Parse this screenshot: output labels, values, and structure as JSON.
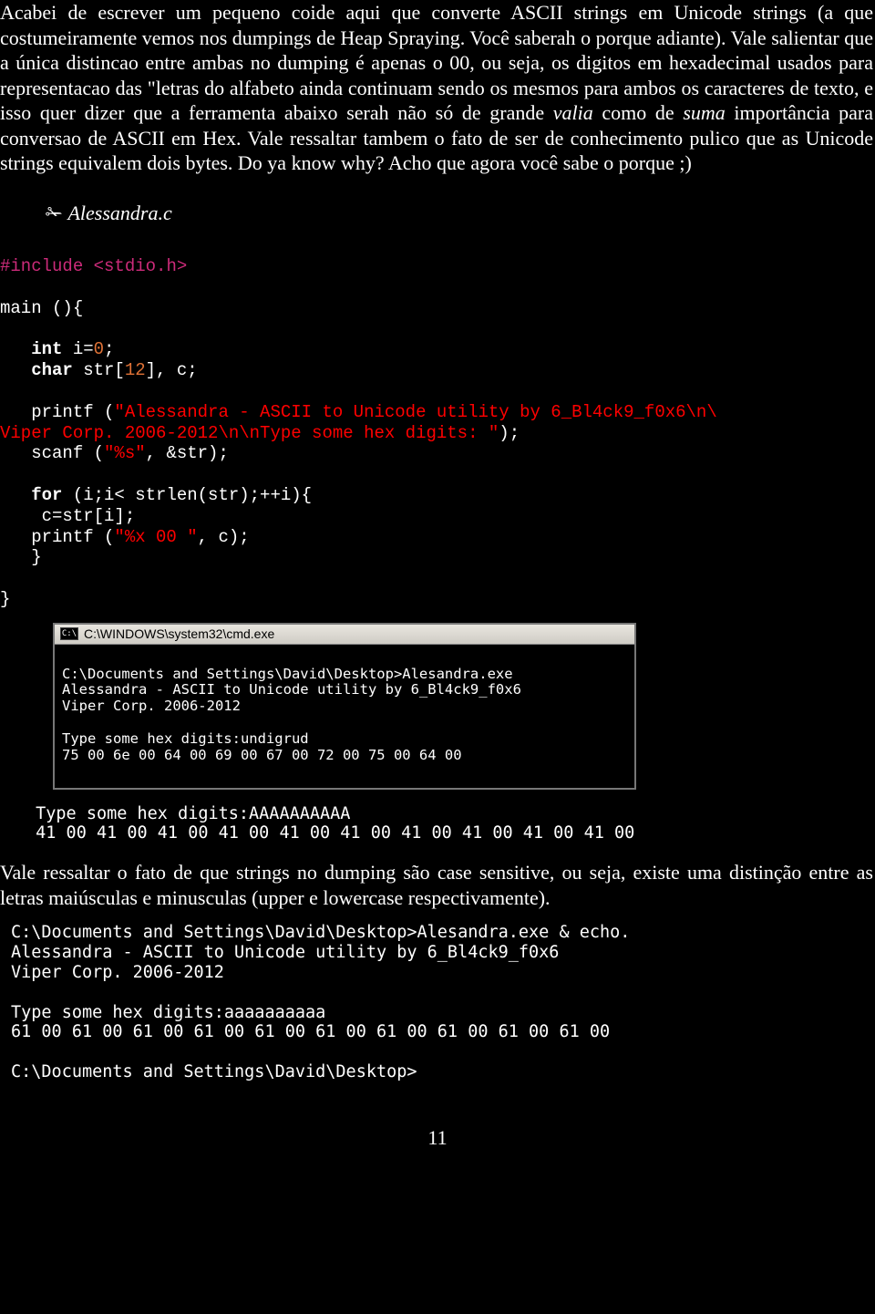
{
  "para1": "Acabei de escrever um pequeno coide aqui que converte ASCII strings em Unicode strings (a que costumeiramente vemos nos dumpings de Heap Spraying. Você saberah o porque adiante). Vale salientar que a única distincao entre ambas no dumping é apenas o 00, ou seja, os digitos em hexadecimal usados para representacao das \"letras do alfabeto ainda continuam sendo os mesmos para ambos os caracteres de texto, e isso quer dizer que a ferramenta abaixo serah não só de grande ",
  "para1_ital1": "valia",
  "para1_mid": " como de ",
  "para1_ital2": "suma",
  "para1_rest": " importância para conversao de ASCII em Hex. Vale ressaltar tambem o fato de ser de conhecimento pulico que as Unicode strings equivalem dois bytes. Do ya know why? Acho que agora você sabe o porque ;)",
  "file_label_icon": "✁",
  "file_label": "Alessandra.c",
  "code": {
    "l1_a": "#include ",
    "l1_b": "<stdio.h>",
    "l2": "main (){",
    "l3_a": "   int",
    "l3_b": " i=",
    "l3_num": "0",
    "l3_c": ";",
    "l4_a": "   char",
    "l4_b": " str[",
    "l4_num": "12",
    "l4_c": "], c;",
    "l5_a": "   printf (",
    "l5_str": "\"Alessandra - ASCII to Unicode utility by 6_Bl4ck9_f0x6\\n\\",
    "l6_str": "Viper Corp. 2006-2012\\n\\nType some hex digits: \"",
    "l6_a": ");",
    "l7_a": "   scanf (",
    "l7_str": "\"%s\"",
    "l7_b": ", &str);",
    "l8_a": "   for",
    "l8_b": " (i;i< strlen(str);++i){",
    "l9": "    c=str[i];",
    "l10_a": "   printf (",
    "l10_str": "\"%x 00 \"",
    "l10_b": ", c);",
    "l11": "   }",
    "l12": "}"
  },
  "cmd": {
    "title_icon": "C:\\",
    "title": "C:\\WINDOWS\\system32\\cmd.exe",
    "body": "\nC:\\Documents and Settings\\David\\Desktop>Alesandra.exe\nAlessandra - ASCII to Unicode utility by 6_Bl4ck9_f0x6\nViper Corp. 2006-2012\n\nType some hex digits:undigrud\n75 00 6e 00 64 00 69 00 67 00 72 00 75 00 64 00"
  },
  "term1": " Type some hex digits:AAAAAAAAAA\n 41 00 41 00 41 00 41 00 41 00 41 00 41 00 41 00 41 00 41 00",
  "para2": "Vale ressaltar o fato de que strings no dumping são case sensitive, ou seja, existe uma distinção entre as letras maiúsculas e minusculas (upper e lowercase respectivamente).",
  "term2": "C:\\Documents and Settings\\David\\Desktop>Alesandra.exe & echo.\nAlessandra - ASCII to Unicode utility by 6_Bl4ck9_f0x6\nViper Corp. 2006-2012\n\nType some hex digits:aaaaaaaaaa\n61 00 61 00 61 00 61 00 61 00 61 00 61 00 61 00 61 00 61 00\n\nC:\\Documents and Settings\\David\\Desktop>",
  "page_number": "11"
}
